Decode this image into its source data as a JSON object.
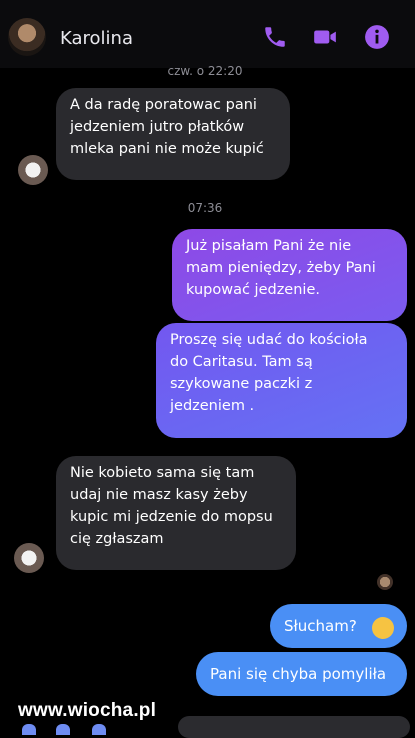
{
  "header": {
    "contact_name": "Karolina",
    "icons": [
      "phone-icon",
      "video-camera-icon",
      "info-icon"
    ],
    "accent_color": "#a05cf0"
  },
  "timestamps": [
    "czw. o 22:20",
    "07:36"
  ],
  "messages": [
    {
      "from": "them",
      "text": "A da radę poratowac pani\njedzeniem jutro płatków\nmleka pani nie może kupić"
    },
    {
      "from": "me",
      "text": "Już pisałam Pani że nie\nmam pieniędzy, żeby Pani\nkupować jedzenie."
    },
    {
      "from": "me",
      "text": "Proszę się udać do kościoła\ndo Caritasu. Tam są\nszykowane paczki z\njedzeniem ."
    },
    {
      "from": "them",
      "text": "Nie kobieto sama się tam\nudaj nie masz kasy żeby\nkupic mi jedzenie do mopsu\ncię zgłaszam"
    },
    {
      "from": "me",
      "text": "Słucham?"
    },
    {
      "from": "me",
      "text": "Pani się chyba pomyliła"
    }
  ],
  "watermark": "www.wiocha.pl"
}
